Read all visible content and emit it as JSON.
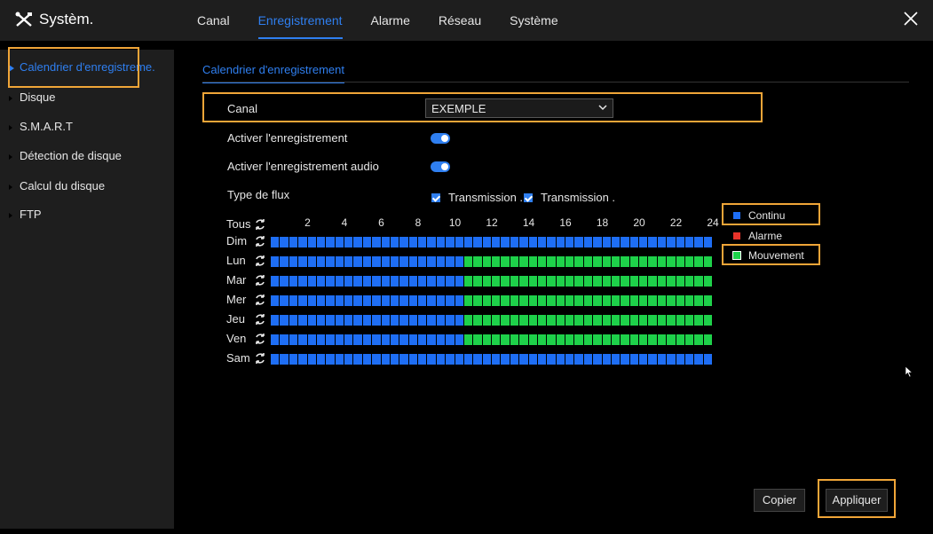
{
  "app": {
    "title": "Systèm."
  },
  "nav": {
    "tabs": [
      "Canal",
      "Enregistrement",
      "Alarme",
      "Réseau",
      "Système"
    ],
    "active": "Enregistrement"
  },
  "sidebar": {
    "items": [
      {
        "label": "Calendrier d'enregistreme."
      },
      {
        "label": "Disque"
      },
      {
        "label": "S.M.A.R.T"
      },
      {
        "label": "Détection de disque"
      },
      {
        "label": "Calcul du disque"
      },
      {
        "label": "FTP"
      }
    ]
  },
  "page": {
    "subtab": "Calendrier d'enregistrement",
    "channel_label": "Canal",
    "channel_value": "EXEMPLE",
    "enable_recording_label": "Activer l'enregistrement",
    "enable_audio_label": "Activer l'enregistrement audio",
    "stream_type_label": "Type de flux",
    "stream_options": [
      "Transmission .",
      "Transmission ."
    ]
  },
  "schedule": {
    "all_label": "Tous",
    "hour_labels": [
      "2",
      "4",
      "6",
      "8",
      "10",
      "12",
      "14",
      "16",
      "18",
      "20",
      "22",
      "24"
    ],
    "days": [
      "Dim",
      "Lun",
      "Mar",
      "Mer",
      "Jeu",
      "Ven",
      "Sam"
    ],
    "cells_per_day": 48,
    "motion_from_cell": 21,
    "motion_days": [
      "Lun",
      "Mar",
      "Mer",
      "Jeu",
      "Ven"
    ]
  },
  "legend": [
    {
      "label": "Continu",
      "color": "#1e6ef5"
    },
    {
      "label": "Alarme",
      "color": "#e8332a"
    },
    {
      "label": "Mouvement",
      "color": "#1ed14a"
    }
  ],
  "buttons": {
    "copy": "Copier",
    "apply": "Appliquer"
  },
  "colors": {
    "accent": "#2f7ff0",
    "highlight": "#f0a538"
  }
}
